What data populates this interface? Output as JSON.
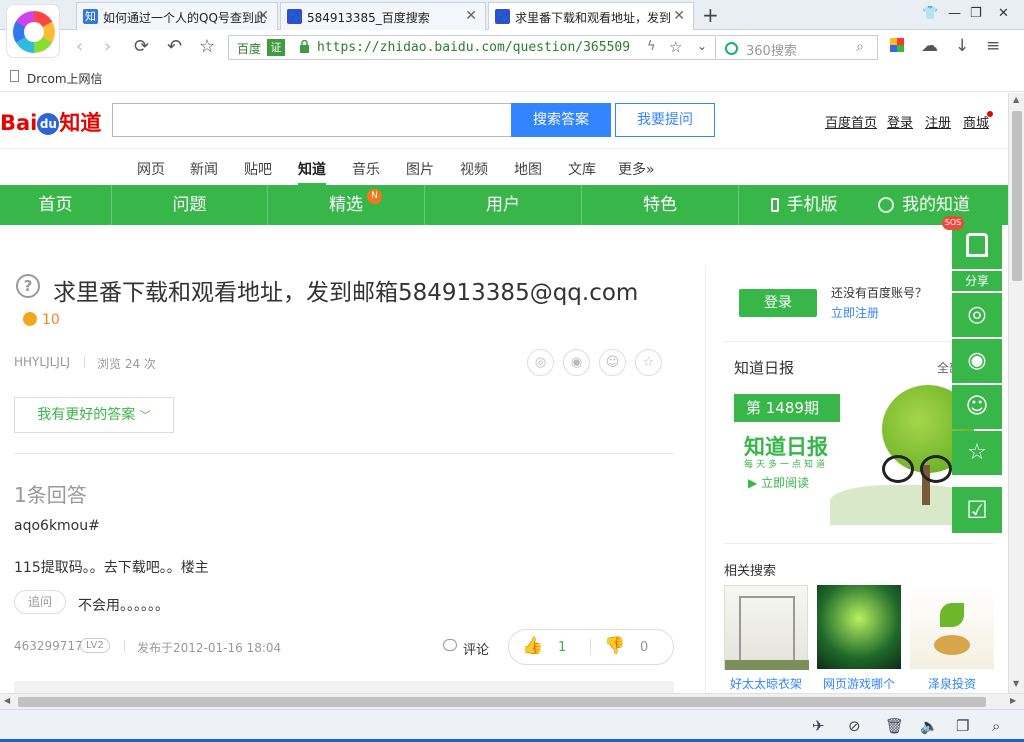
{
  "browser": {
    "tabs": [
      {
        "title": "如何通过一个人的QQ号查到此",
        "fav_color": "#2e7ad6",
        "fav_text": "知"
      },
      {
        "title": "584913385_百度搜索",
        "fav_color": "#2d4fd0",
        "fav_text": "🐾"
      },
      {
        "title": "求里番下载和观看地址，发到",
        "fav_color": "#2d4fd0",
        "fav_text": "🐾"
      }
    ],
    "new_tab": "+",
    "window_controls": [
      "👕",
      "—",
      "❐",
      "✕"
    ],
    "address": {
      "site_name": "百度",
      "cert_label": "证",
      "url": "https://zhidao.baidu.com/question/365509"
    },
    "search_placeholder": "360搜索",
    "bookmark": "Drcom上网信"
  },
  "header": {
    "logo": {
      "bai": "Bai",
      "du": "du",
      "zhidao": "知道"
    },
    "search_button": "搜索答案",
    "ask_button": "我要提问",
    "links": [
      "百度首页",
      "登录",
      "注册",
      "商城"
    ]
  },
  "categories": [
    "网页",
    "新闻",
    "贴吧",
    "知道",
    "音乐",
    "图片",
    "视频",
    "地图",
    "文库",
    "更多»"
  ],
  "active_category": "知道",
  "greennav": {
    "items": [
      "首页",
      "问题",
      "精选",
      "用户",
      "特色"
    ],
    "mobile": "手机版",
    "mine": "我的知道",
    "badge": "N"
  },
  "question": {
    "title": "求里番下载和观看地址，发到邮箱584913385@qq.com",
    "reward": "10",
    "asker": "HHYLJLJLJ",
    "views": "浏览 24 次",
    "better_answer": "我有更好的答案"
  },
  "answer": {
    "count_label": "1条回答",
    "user_line": "aqo6kmou#",
    "text": "115提取码。。去下载吧。。楼主",
    "followup_label": "追问",
    "followup_text": "不会用。。。。。。",
    "answerer": "463299717",
    "level": "LV2",
    "posted": "发布于2012-01-16 18:04",
    "comment": "评论",
    "up": "1",
    "down": "0"
  },
  "sidebar_right": {
    "login": "登录",
    "no_account": "还没有百度账号？",
    "register": "立即注册",
    "daily_title": "知道日报",
    "daily_more": "全部",
    "banner": {
      "issue": "第 1489期",
      "brand": "知道日报",
      "slogan": "每天多一点知道",
      "read_now": "立即阅读"
    },
    "related_title": "相关搜索",
    "related": [
      "好太太晾衣架",
      "网页游戏哪个",
      "泽泉投资"
    ]
  },
  "float_bar": {
    "sos": "SOS",
    "share": "分享"
  }
}
